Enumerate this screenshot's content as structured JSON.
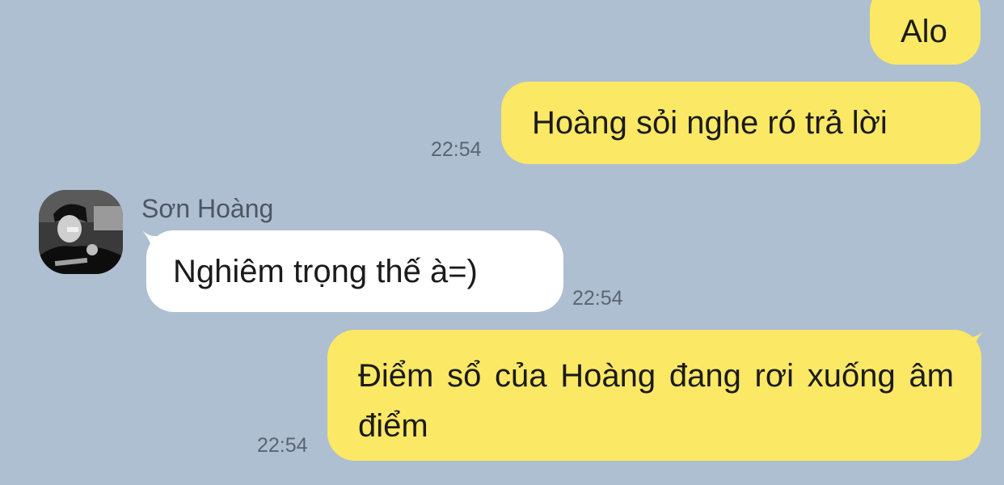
{
  "conversation": {
    "contact_name": "Sơn Hoàng",
    "messages": [
      {
        "from": "me",
        "text": "Alo"
      },
      {
        "from": "me",
        "text": "Hoàng sỏi nghe ró trả lời",
        "time": "22:54"
      },
      {
        "from": "Sơn Hoàng",
        "text": "Nghiêm trọng thế à=)",
        "time": "22:54"
      },
      {
        "from": "me",
        "text": "Điểm sổ của Hoàng đang rơi xuống âm điểm",
        "time": "22:54"
      }
    ]
  },
  "colors": {
    "background": "#aebfd1",
    "outgoing_bubble": "#fbe865",
    "incoming_bubble": "#ffffff",
    "timestamp_text": "#5b6572"
  },
  "icons": {
    "avatar": "contact-avatar-photo"
  }
}
